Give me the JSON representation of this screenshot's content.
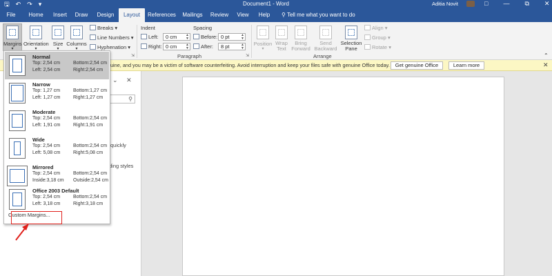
{
  "titlebar": {
    "document_title": "Document1 - Word",
    "user_name": "Aditia Novit",
    "icons": [
      "save-icon",
      "undo-icon",
      "redo-icon",
      "customize-qat-icon"
    ],
    "window_controls": [
      "ribbon-display-icon",
      "minimize-icon",
      "restore-icon",
      "close-icon"
    ]
  },
  "tabs": [
    "File",
    "Home",
    "Insert",
    "Draw",
    "Design",
    "Layout",
    "References",
    "Mailings",
    "Review",
    "View",
    "Help"
  ],
  "active_tab": "Layout",
  "tell_me": "Tell me what you want to do",
  "ribbon": {
    "page_setup": {
      "margins": "Margins",
      "orientation": "Orientation",
      "size": "Size",
      "columns": "Columns",
      "breaks": "Breaks",
      "line_numbers": "Line Numbers",
      "hyphenation": "Hyphenation"
    },
    "paragraph": {
      "indent_label": "Indent",
      "spacing_label": "Spacing",
      "left_label": "Left:",
      "right_label": "Right:",
      "before_label": "Before:",
      "after_label": "After:",
      "left_value": "0 cm",
      "right_value": "0 cm",
      "before_value": "0 pt",
      "after_value": "8 pt",
      "group_label": "Paragraph"
    },
    "arrange": {
      "position": "Position",
      "wrap_text_1": "Wrap",
      "wrap_text_2": "Text",
      "bring_forward_1": "Bring",
      "bring_forward_2": "Forward",
      "send_backward_1": "Send",
      "send_backward_2": "Backward",
      "selection_pane_1": "Selection",
      "selection_pane_2": "Pane",
      "align": "Align",
      "group": "Group",
      "rotate": "Rotate",
      "group_label": "Arrange"
    }
  },
  "message_bar": {
    "text": "uine, and you may be a victim of software counterfeiting. Avoid interruption and keep your files safe with genuine Office today.",
    "get_genuine": "Get genuine Office",
    "learn_more": "Learn more"
  },
  "nav_pane_fragments": {
    "quickly": "quickly",
    "heading_styles": "ding styles"
  },
  "margins_menu": {
    "options": [
      {
        "name": "Normal",
        "top": "Top:  2,54 cm",
        "bottom": "Bottom:2,54 cm",
        "left": "Left:  2,54 cm",
        "right": "Right:2,54 cm"
      },
      {
        "name": "Narrow",
        "top": "Top:  1,27 cm",
        "bottom": "Bottom:1,27 cm",
        "left": "Left:  1,27 cm",
        "right": "Right:1,27 cm"
      },
      {
        "name": "Moderate",
        "top": "Top:  2,54 cm",
        "bottom": "Bottom:2,54 cm",
        "left": "Left:  1,91 cm",
        "right": "Right:1,91 cm"
      },
      {
        "name": "Wide",
        "top": "Top:  2,54 cm",
        "bottom": "Bottom:2,54 cm",
        "left": "Left:  5,08 cm",
        "right": "Right:5,08 cm"
      },
      {
        "name": "Mirrored",
        "top": "Top:  2,54 cm",
        "bottom": "Bottom:2,54 cm",
        "left": "Inside:3,18 cm",
        "right": "Outside:2,54 cm"
      },
      {
        "name": "Office 2003 Default",
        "top": "Top:  2,54 cm",
        "bottom": "Bottom:2,54 cm",
        "left": "Left:  3,18 cm",
        "right": "Right:3,18 cm"
      }
    ],
    "selected": "Normal",
    "custom_margins": "Custom Margins..."
  },
  "colors": {
    "accent": "#2b579a",
    "highlight": "#e0201b",
    "message_bar": "#fcf7c4"
  }
}
